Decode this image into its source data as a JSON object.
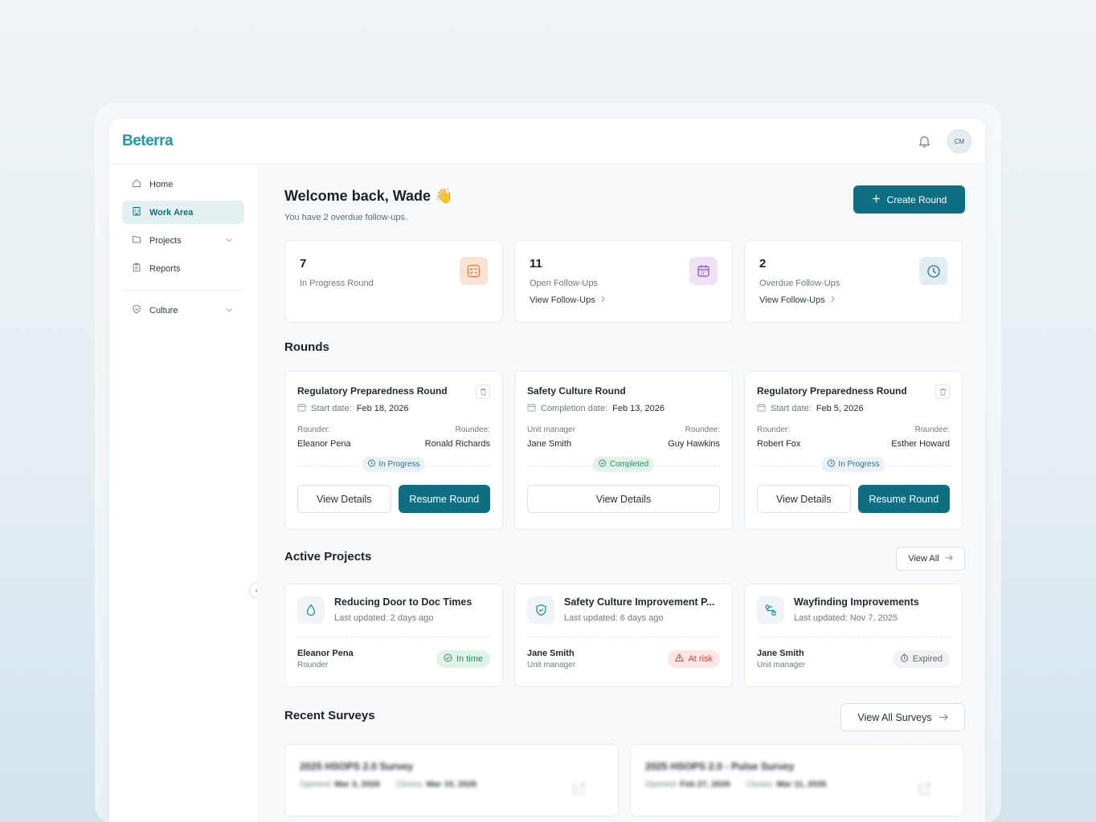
{
  "app": {
    "logo": "Beterra",
    "avatar_initials": "CM"
  },
  "sidebar": {
    "items": [
      {
        "label": "Home",
        "icon": "home-icon"
      },
      {
        "label": "Work Area",
        "icon": "building-icon",
        "active": true
      },
      {
        "label": "Projects",
        "icon": "folder-icon",
        "has_chevron": true
      },
      {
        "label": "Reports",
        "icon": "clipboard-icon"
      }
    ],
    "secondary": [
      {
        "label": "Culture",
        "icon": "shield-icon",
        "has_chevron": true
      }
    ]
  },
  "header": {
    "welcome": "Welcome back, Wade 👋",
    "subtitle": "You have 2 overdue follow-ups.",
    "create_button": "Create Round"
  },
  "stats": [
    {
      "value": "7",
      "label": "In Progress Round",
      "link": "",
      "icon": "checklist-icon",
      "color": "#f6e3d5"
    },
    {
      "value": "11",
      "label": "Open Follow-Ups",
      "link": "View Follow-Ups",
      "icon": "calendar-icon",
      "color": "#ede3f6"
    },
    {
      "value": "2",
      "label": "Overdue Follow-Ups",
      "link": "View Follow-Ups",
      "icon": "clock-icon",
      "color": "#e4eef5"
    }
  ],
  "rounds": {
    "title": "Rounds",
    "cards": [
      {
        "title": "Regulatory Preparedness Round",
        "date_label": "Start date:",
        "date": "Feb 18, 2026",
        "left_label": "Rounder:",
        "left_value": "Eleanor Pena",
        "right_label": "Roundee:",
        "right_value": "Ronald Richards",
        "status": "In Progress",
        "view": "View Details",
        "resume": "Resume Round"
      },
      {
        "title": "Safety Culture Round",
        "date_label": "Completion date:",
        "date": "Feb 13, 2026",
        "left_label": "Unit manager",
        "left_value": "Jane Smith",
        "right_label": "Roundee:",
        "right_value": "Guy Hawkins",
        "status": "Completed",
        "view": "View Details"
      },
      {
        "title": "Regulatory Preparedness Round",
        "date_label": "Start date:",
        "date": "Feb 5, 2026",
        "left_label": "Rounder:",
        "left_value": "Robert Fox",
        "right_label": "Roundee:",
        "right_value": "Esther Howard",
        "status": "In Progress",
        "view": "View Details",
        "resume": "Resume Round"
      }
    ]
  },
  "projects": {
    "title": "Active Projects",
    "view_all": "View All",
    "cards": [
      {
        "title": "Reducing Door to Doc Times",
        "updated": "Last updated: 2 days ago",
        "person": "Eleanor Pena",
        "role": "Rounder",
        "badge": "In time",
        "icon": "droplet-icon"
      },
      {
        "title": "Safety Culture Improvement P...",
        "updated": "Last updated: 6 days ago",
        "person": "Jane Smith",
        "role": "Unit manager",
        "badge": "At risk",
        "icon": "shield-check-icon"
      },
      {
        "title": "Wayfinding Improvements",
        "updated": "Last updated: Nov 7, 2025",
        "person": "Jane Smith",
        "role": "Unit manager",
        "badge": "Expired",
        "icon": "route-icon"
      }
    ]
  },
  "surveys": {
    "title": "Recent Surveys",
    "view_all": "View All Surveys",
    "cards": [
      {
        "title": "2025 HSOPS 2.0 Survey",
        "opened_label": "Opened:",
        "opened": "Mar 3, 2026",
        "closes_label": "Closes:",
        "closes": "Mar 10, 2026"
      },
      {
        "title": "2025 HSOPS 2.0 - Pulse Survey",
        "opened_label": "Opened:",
        "opened": "Feb 27, 2026",
        "closes_label": "Closes:",
        "closes": "Mar 11, 2026"
      }
    ]
  }
}
